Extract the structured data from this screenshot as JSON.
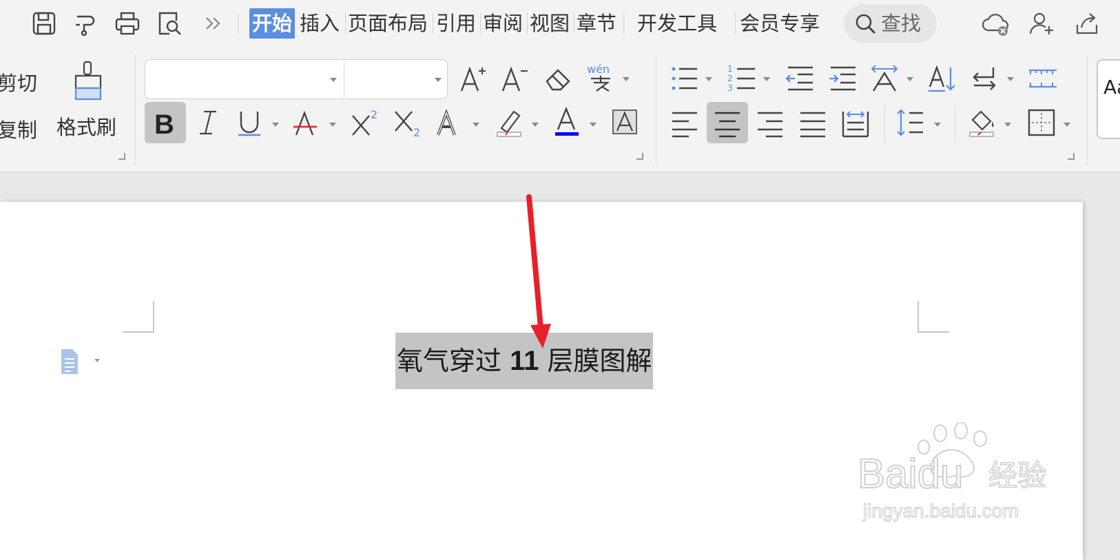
{
  "menu": {
    "tabs": [
      "开始",
      "插入",
      "页面布局",
      "引用",
      "审阅",
      "视图",
      "章节",
      "开发工具",
      "会员专享"
    ],
    "search_label": "查找"
  },
  "ribbon": {
    "clipboard": {
      "cut": "剪切",
      "copy": "复制",
      "format_painter": "格式刷"
    },
    "font": {
      "font_name": "",
      "font_size": ""
    },
    "styles_preview": "Aa"
  },
  "document": {
    "title_part1": "氧气穿过 ",
    "title_number": "11",
    "title_part2": " 层膜图解"
  },
  "watermark": {
    "brand": "Baidu",
    "product": "经验",
    "url": "jingyan.baidu.com"
  },
  "colors": {
    "accent": "#5b8de0",
    "font_color_bar": "#0000ff",
    "arrow": "#e8202a",
    "selection": "#c4c4c4"
  }
}
